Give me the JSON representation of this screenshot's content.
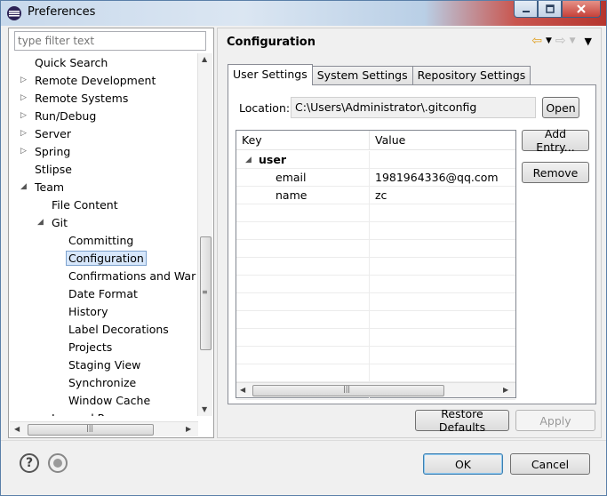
{
  "window": {
    "title": "Preferences"
  },
  "filter": {
    "placeholder": "type filter text"
  },
  "tree": [
    {
      "label": "Quick Search",
      "indent": 0,
      "arrow": ""
    },
    {
      "label": "Remote Development",
      "indent": 0,
      "arrow": "collapsed"
    },
    {
      "label": "Remote Systems",
      "indent": 0,
      "arrow": "collapsed"
    },
    {
      "label": "Run/Debug",
      "indent": 0,
      "arrow": "collapsed"
    },
    {
      "label": "Server",
      "indent": 0,
      "arrow": "collapsed"
    },
    {
      "label": "Spring",
      "indent": 0,
      "arrow": "collapsed"
    },
    {
      "label": "Stlipse",
      "indent": 0,
      "arrow": ""
    },
    {
      "label": "Team",
      "indent": 0,
      "arrow": "expanded"
    },
    {
      "label": "File Content",
      "indent": 1,
      "arrow": ""
    },
    {
      "label": "Git",
      "indent": 1,
      "arrow": "expanded"
    },
    {
      "label": "Committing",
      "indent": 2,
      "arrow": ""
    },
    {
      "label": "Configuration",
      "indent": 2,
      "arrow": "",
      "selected": true
    },
    {
      "label": "Confirmations and War",
      "indent": 2,
      "arrow": ""
    },
    {
      "label": "Date Format",
      "indent": 2,
      "arrow": ""
    },
    {
      "label": "History",
      "indent": 2,
      "arrow": ""
    },
    {
      "label": "Label Decorations",
      "indent": 2,
      "arrow": ""
    },
    {
      "label": "Projects",
      "indent": 2,
      "arrow": ""
    },
    {
      "label": "Staging View",
      "indent": 2,
      "arrow": ""
    },
    {
      "label": "Synchronize",
      "indent": 2,
      "arrow": ""
    },
    {
      "label": "Window Cache",
      "indent": 2,
      "arrow": ""
    },
    {
      "label": "Ignored Resources",
      "indent": 1,
      "arrow": ""
    }
  ],
  "page": {
    "title": "Configuration"
  },
  "tabs": [
    {
      "label": "User Settings",
      "active": true
    },
    {
      "label": "System Settings",
      "active": false
    },
    {
      "label": "Repository Settings",
      "active": false
    }
  ],
  "location": {
    "label": "Location:",
    "value": "C:\\Users\\Administrator\\.gitconfig",
    "open_label": "Open"
  },
  "table": {
    "headers": {
      "key": "Key",
      "value": "Value"
    },
    "rows": [
      {
        "key": "user",
        "value": "",
        "group": true
      },
      {
        "key": "email",
        "value": "1981964336@qq.com",
        "group": false
      },
      {
        "key": "name",
        "value": "zc",
        "group": false
      }
    ],
    "empty_rows": 11
  },
  "side_buttons": {
    "add": "Add Entry...",
    "remove": "Remove"
  },
  "page_buttons": {
    "restore": "Restore Defaults",
    "apply": "Apply"
  },
  "dialog_buttons": {
    "ok": "OK",
    "cancel": "Cancel"
  }
}
